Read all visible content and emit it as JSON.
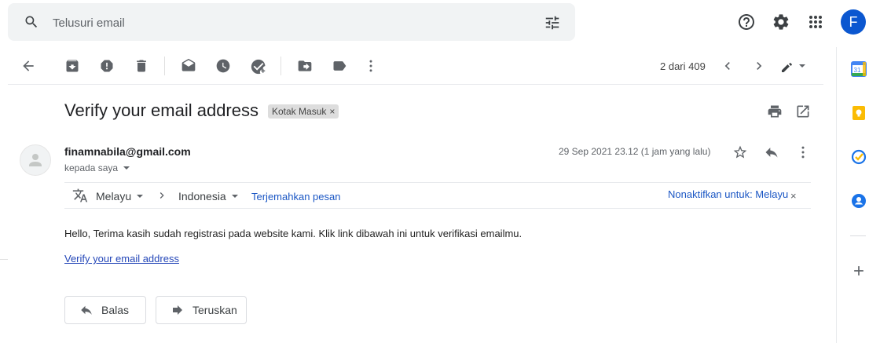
{
  "search": {
    "placeholder": "Telusuri email"
  },
  "account": {
    "avatar_letter": "F"
  },
  "toolbar": {
    "pager": "2 dari 409"
  },
  "message": {
    "subject": "Verify your email address",
    "label": "Kotak Masuk",
    "label_close": "×",
    "sender_email": "finamnabila@gmail.com",
    "recipient": "kepada saya",
    "date": "29 Sep 2021 23.12 (1 jam yang lalu)",
    "body": "Hello, Terima kasih sudah registrasi pada website kami. Klik link dibawah ini untuk verifikasi emailmu.",
    "link": "Verify your email address"
  },
  "translation": {
    "from_lang": "Melayu",
    "to_lang": "Indonesia",
    "translate_link": "Terjemahkan pesan",
    "disable_link": "Nonaktifkan untuk: Melayu",
    "close": "×"
  },
  "actions": {
    "reply": "Balas",
    "forward": "Teruskan"
  },
  "side_panel": {
    "calendar_day": "31"
  },
  "colors": {
    "link_blue": "#1a56c4",
    "keep_yellow": "#fbbc04",
    "tasks_blue": "#1a73e8",
    "contacts_blue": "#1a73e8",
    "avatar_blue": "#0b57d0"
  }
}
